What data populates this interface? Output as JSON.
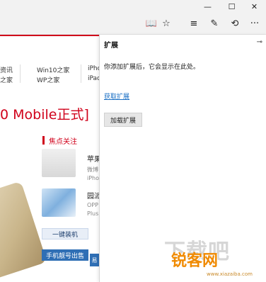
{
  "window_controls": {
    "minimize": "—",
    "maximize": "☐",
    "close": "✕"
  },
  "toolbar": {
    "icons": [
      {
        "name": "reading-view-icon",
        "glyph": "📖"
      },
      {
        "name": "favorites-star-icon",
        "glyph": "☆"
      },
      {
        "name": "hub-icon",
        "glyph": "≡"
      },
      {
        "name": "web-note-icon",
        "glyph": "✎"
      },
      {
        "name": "share-icon",
        "glyph": "⟲"
      },
      {
        "name": "more-icon",
        "glyph": "···"
      }
    ]
  },
  "page": {
    "nav": {
      "col1": [
        "资讯",
        "之家"
      ],
      "col2": [
        "Win10之家",
        "WP之家"
      ],
      "col3": [
        "iPho",
        "iPac"
      ]
    },
    "headline": "0 Mobile正式]",
    "section_title": "焦点关注",
    "news": [
      {
        "title": "苹果",
        "sub1": "微博",
        "sub2": "iPho"
      },
      {
        "title": "园派",
        "sub1": "OPP",
        "sub2": "Plus"
      }
    ],
    "buttons": [
      "一键装机",
      "手机靓号出售",
      "易"
    ]
  },
  "extensions_panel": {
    "title": "扩展",
    "pin_glyph": "⊸",
    "message": "你添加扩展后，它会显示在此处。",
    "get_link": "获取扩展",
    "load_button": "加载扩展"
  },
  "watermark": {
    "main": "下载吧",
    "brand": "锐客网",
    "url": "www.xiazaiba.com"
  }
}
